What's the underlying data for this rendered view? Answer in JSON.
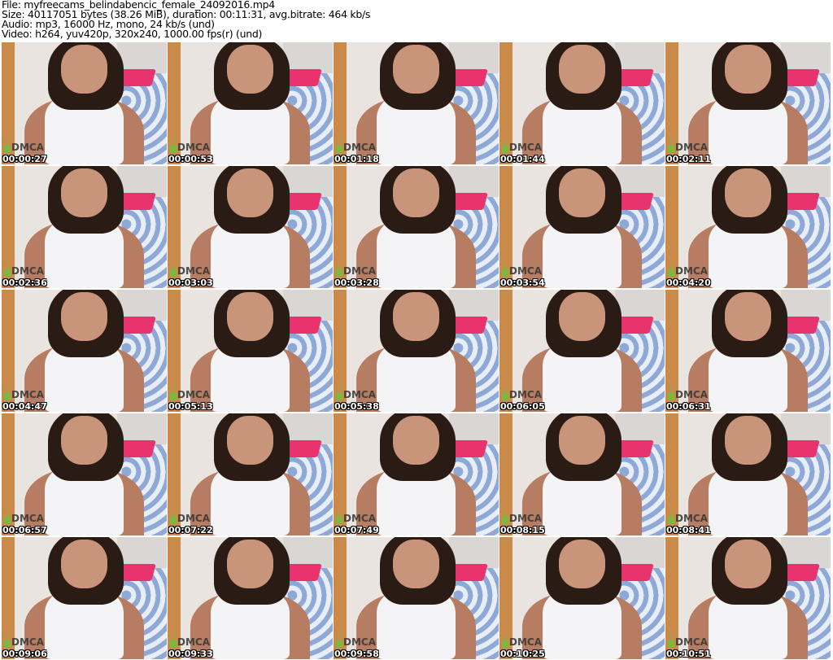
{
  "header": {
    "file": "File: myfreecams_belindabencic_female_24092016.mp4",
    "size": "Size: 40117051 bytes (38.26 MiB), duration: 00:11:31, avg.bitrate: 464 kb/s",
    "audio": "Audio: mp3, 16000 Hz, mono, 24 kb/s (und)",
    "video": "Video: h264, yuv420p, 320x240, 1000.00 fps(r) (und)"
  },
  "watermark": "DMCA",
  "frames": [
    {
      "time": "00:00:27"
    },
    {
      "time": "00:00:53"
    },
    {
      "time": "00:01:18"
    },
    {
      "time": "00:01:44"
    },
    {
      "time": "00:02:11"
    },
    {
      "time": "00:02:36"
    },
    {
      "time": "00:03:03"
    },
    {
      "time": "00:03:28"
    },
    {
      "time": "00:03:54"
    },
    {
      "time": "00:04:20"
    },
    {
      "time": "00:04:47"
    },
    {
      "time": "00:05:13"
    },
    {
      "time": "00:05:38"
    },
    {
      "time": "00:06:05"
    },
    {
      "time": "00:06:31"
    },
    {
      "time": "00:06:57"
    },
    {
      "time": "00:07:22"
    },
    {
      "time": "00:07:49"
    },
    {
      "time": "00:08:15"
    },
    {
      "time": "00:08:41"
    },
    {
      "time": "00:09:06"
    },
    {
      "time": "00:09:33"
    },
    {
      "time": "00:09:58"
    },
    {
      "time": "00:10:25"
    },
    {
      "time": "00:10:51"
    }
  ]
}
